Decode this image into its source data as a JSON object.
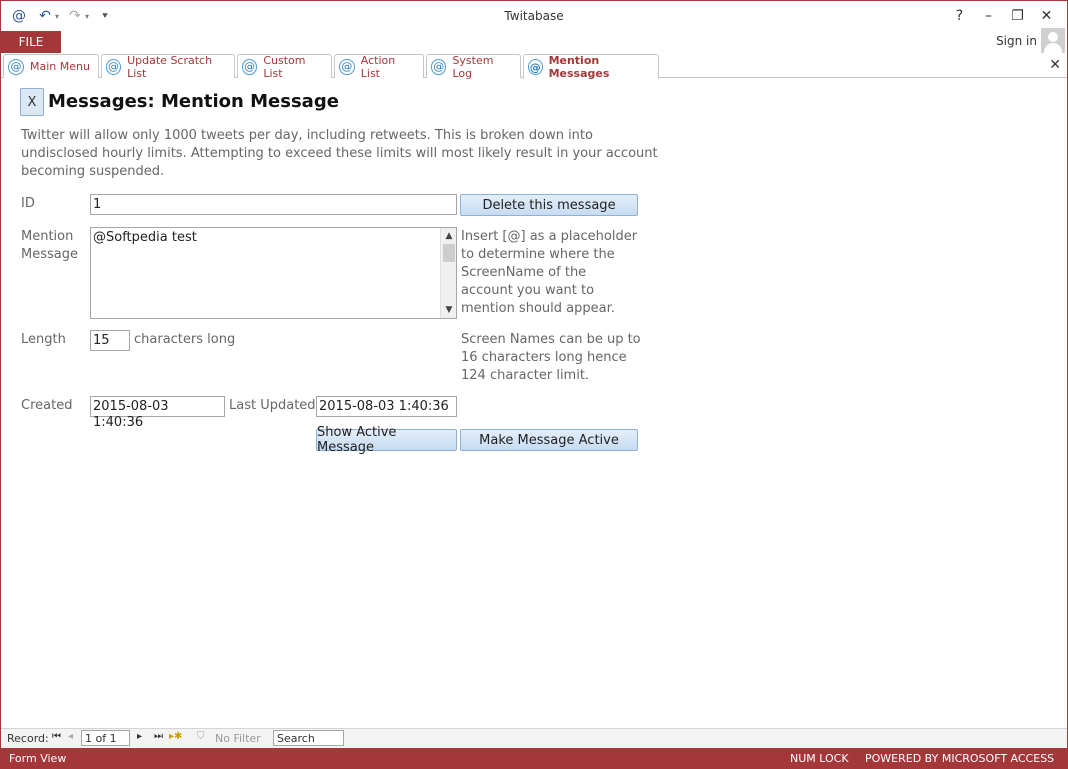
{
  "window": {
    "title": "Twitabase"
  },
  "qat": {
    "app_icon": "at-icon",
    "undo_icon": "undo-icon",
    "redo_icon": "redo-icon",
    "customize_icon": "customize-qat-icon"
  },
  "window_controls": {
    "help": "?",
    "minimize": "–",
    "restore": "❐",
    "close": "✕"
  },
  "ribbon": {
    "file_label": "FILE",
    "sign_in_label": "Sign in"
  },
  "doc_tabs": [
    {
      "label": "Main Menu"
    },
    {
      "label": "Update Scratch List"
    },
    {
      "label": "Custom List"
    },
    {
      "label": "Action List"
    },
    {
      "label": "System Log"
    },
    {
      "label": "Mention Messages"
    }
  ],
  "form": {
    "close_label": "X",
    "title": "Messages: Mention Message",
    "description": "Twitter will allow only 1000 tweets per day, including retweets.  This is broken down into undisclosed hourly limits.  Attempting to exceed these limits will most likely result in your account becoming suspended.",
    "id_label": "ID",
    "id_value": "1",
    "delete_button": "Delete this message",
    "mention_label_1": "Mention",
    "mention_label_2": "Message",
    "mention_value": "@Softpedia test",
    "mention_hint": "Insert [@] as a placeholder to determine where the ScreenName of the account you want to mention should appear.",
    "length_label": "Length",
    "length_value": "15",
    "length_suffix": "characters long",
    "length_hint": "Screen Names can be up to 16 characters long hence 124 character limit.",
    "created_label": "Created",
    "created_value": "2015-08-03 1:40:36",
    "updated_label": "Last Updated",
    "updated_value": "2015-08-03 1:40:36",
    "show_active_button": "Show Active Message",
    "make_active_button": "Make Message Active"
  },
  "record_nav": {
    "record_label": "Record:",
    "position": "1 of 1",
    "filter_label": "No Filter",
    "search_placeholder": "Search"
  },
  "status": {
    "view": "Form View",
    "numlock": "NUM LOCK",
    "powered": "POWERED BY MICROSOFT ACCESS"
  },
  "colors": {
    "accent": "#a4373a",
    "button_border": "#8fb1d6"
  }
}
